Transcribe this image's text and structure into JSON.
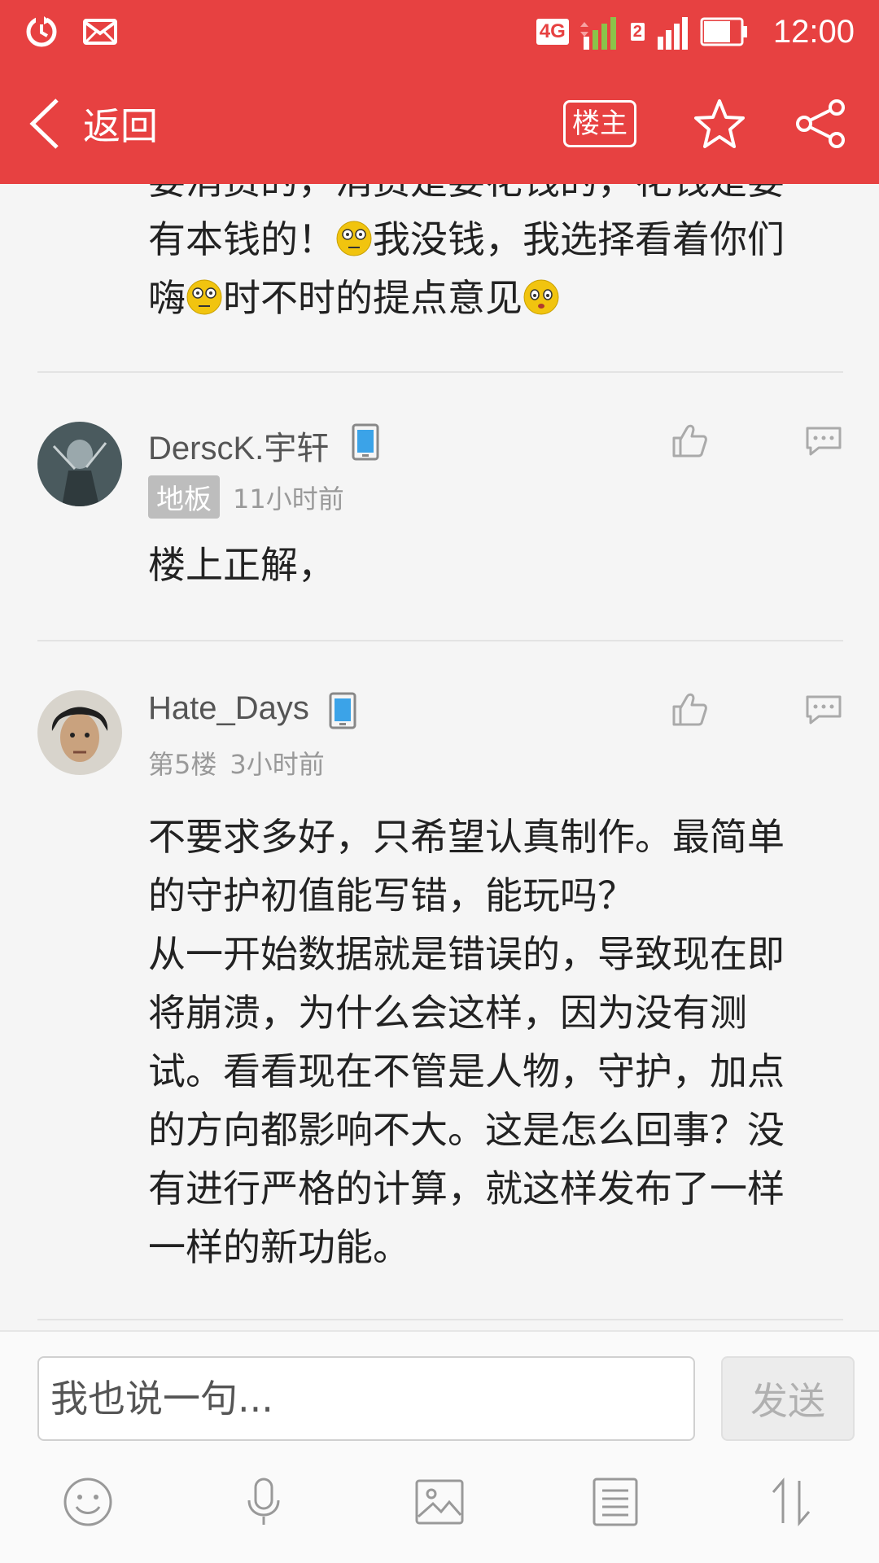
{
  "status_bar": {
    "network": "4G",
    "sim1": "1",
    "sim2": "2",
    "time": "12:00"
  },
  "nav": {
    "back_label": "返回",
    "op_label": "楼主"
  },
  "prev_post": {
    "line1": "要消费的，消费是要花钱的，花钱是要",
    "line2a": "有本钱的！",
    "line2b": "我没钱，我选择看着你们",
    "line3a": "嗨",
    "line3b": "时不时的提点意见"
  },
  "replies": [
    {
      "username": "DerscK.宇轩",
      "floor": "地板",
      "time": "11小时前",
      "text": "楼上正解，"
    },
    {
      "username": "Hate_Days",
      "floor": "第5楼",
      "time": "3小时前",
      "text_lines": [
        "不要求多好，只希望认真制作。最简单",
        "的守护初值能写错，能玩吗？",
        "从一开始数据就是错误的，导致现在即",
        "将崩溃，为什么会这样，因为没有测",
        "试。看看现在不管是人物，守护，加点",
        "的方向都影响不大。这是怎么回事？没",
        "有进行严格的计算，就这样发布了一样",
        "一样的新功能。"
      ]
    }
  ],
  "input": {
    "placeholder": "我也说一句...",
    "send_label": "发送"
  },
  "colors": {
    "brand": "#e74141",
    "background": "#f5f5f5"
  },
  "toolbar": [
    "emoji-icon",
    "microphone-icon",
    "image-icon",
    "list-icon",
    "sort-icon"
  ]
}
